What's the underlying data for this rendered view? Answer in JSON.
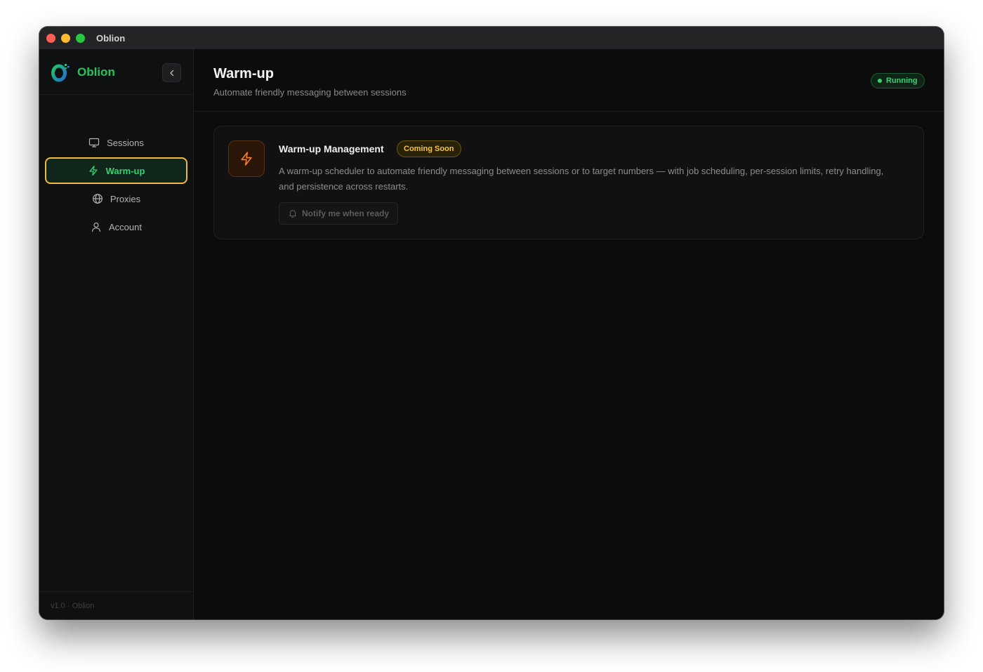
{
  "window": {
    "title": "Oblion"
  },
  "sidebar": {
    "brand_name": "Oblion",
    "items": [
      {
        "label": "Sessions",
        "icon": "monitor-icon",
        "active": false
      },
      {
        "label": "Warm-up",
        "icon": "lightning-icon",
        "active": true
      },
      {
        "label": "Proxies",
        "icon": "globe-icon",
        "active": false
      },
      {
        "label": "Account",
        "icon": "user-icon",
        "active": false
      }
    ],
    "footer_version": "v1.0 · Oblion"
  },
  "header": {
    "title": "Warm-up",
    "subtitle": "Automate friendly messaging between sessions",
    "status": "Running"
  },
  "card": {
    "title": "Warm-up Management",
    "badge": "Coming Soon",
    "description": "A warm-up scheduler to automate friendly messaging between sessions or to target numbers — with job scheduling, per-session limits, retry handling, and persistence across restarts.",
    "button_label": "Notify me when ready"
  },
  "colors": {
    "accent": "#22c55e",
    "active_border": "#f2b93b",
    "badge_amber": "#f5c542",
    "icon_orange": "#f07a2c"
  }
}
